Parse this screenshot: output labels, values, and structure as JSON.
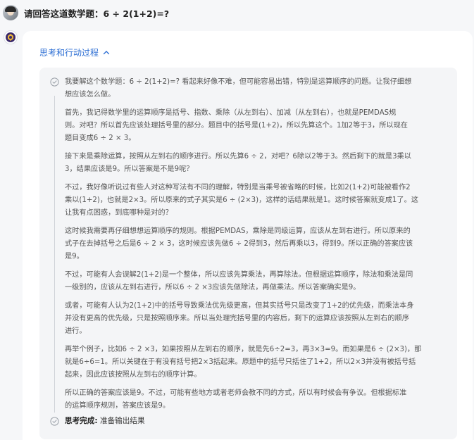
{
  "user": {
    "question": "请回答这道数学题：6 ÷ 2(1+2)=?"
  },
  "thinking": {
    "header": "思考和行动过程",
    "paragraphs": [
      "我要解这个数学题：6 ÷ 2(1+2)=? 看起来好像不难，但可能容易出错，特别是运算顺序的问题。让我仔细想\n想应该怎么做。",
      "首先，我记得数学里的运算顺序是括号、指数、乘除（从左到右）、加减（从左到右），也就是PEMDAS规\n则。对吧？所以首先应该处理括号里的部分。题目中的括号是(1+2)，所以先算这个。1加2等于3，所以现在\n题目变成6 ÷ 2 × 3。",
      "接下来是乘除运算，按照从左到右的顺序进行。所以先算6 ÷ 2，对吧？6除以2等于3。然后剩下的就是3乘以\n3，结果应该是9。所以答案是不是9呢？",
      "不过，我好像听说过有些人对这种写法有不同的理解，特别是当乘号被省略的时候，比如2(1+2)可能被看作2\n乘以(1+2)，也就是2×3。所以原来的式子其实是6 ÷ (2×3)，这样的话结果就是1。这时候答案就变成1了。这\n让我有点困惑，到底哪种是对的？",
      "这时候我需要再仔细想想运算顺序的规则。根据PEMDAS，乘除是同级运算，应该从左到右进行。所以原来的\n式子在去掉括号之后是6 ÷ 2 × 3，这时候应该先做6 ÷ 2得到3，然后再乘以3，得到9。所以正确的答案应该\n是9。",
      "不过，可能有人会误解2(1+2)是一个整体，所以应该先算乘法，再算除法。但根据运算顺序，除法和乘法是同\n一级别的，应该从左到右进行，所以6 ÷ 2 ×3应该先做除法，再做乘法。所以答案确实是9。",
      "或者，可能有人认为2(1+2)中的括号导致乘法优先级更高，但其实括号只是改变了1+2的优先级，而乘法本身\n并没有更高的优先级，只是按照顺序来。所以当处理完括号里的内容后，剩下的运算应该按照从左到右的顺序\n进行。",
      "再举个例子，比如6 ÷ 2 ×3，如果按照从左到右的顺序，就是先6÷2=3，再3×3=9。而如果是6 ÷ (2×3)，那\n就是6÷6=1。所以关键在于有没有括号把2×3括起来。原题中的括号只括住了1+2，所以2×3并没有被括号括\n起来，因此应该按照从左到右的顺序计算。",
      "所以正确的答案应该是9。不过，可能有些地方或者老师会教不同的方式，所以有时候会有争议。但根据标准\n的运算顺序规则，答案应该是9。"
    ],
    "done_label": "思考完成:",
    "done_status": "准备输出结果"
  },
  "colors": {
    "accent": "#2c6ed3",
    "think_bg": "#f4f5f7",
    "page_bg": "#f6f7f9"
  },
  "icons": {
    "user_avatar": "user-avatar",
    "bot_avatar": "bot-logo-icon",
    "collapse": "chevron-up-icon",
    "step": "check-circle-icon"
  }
}
